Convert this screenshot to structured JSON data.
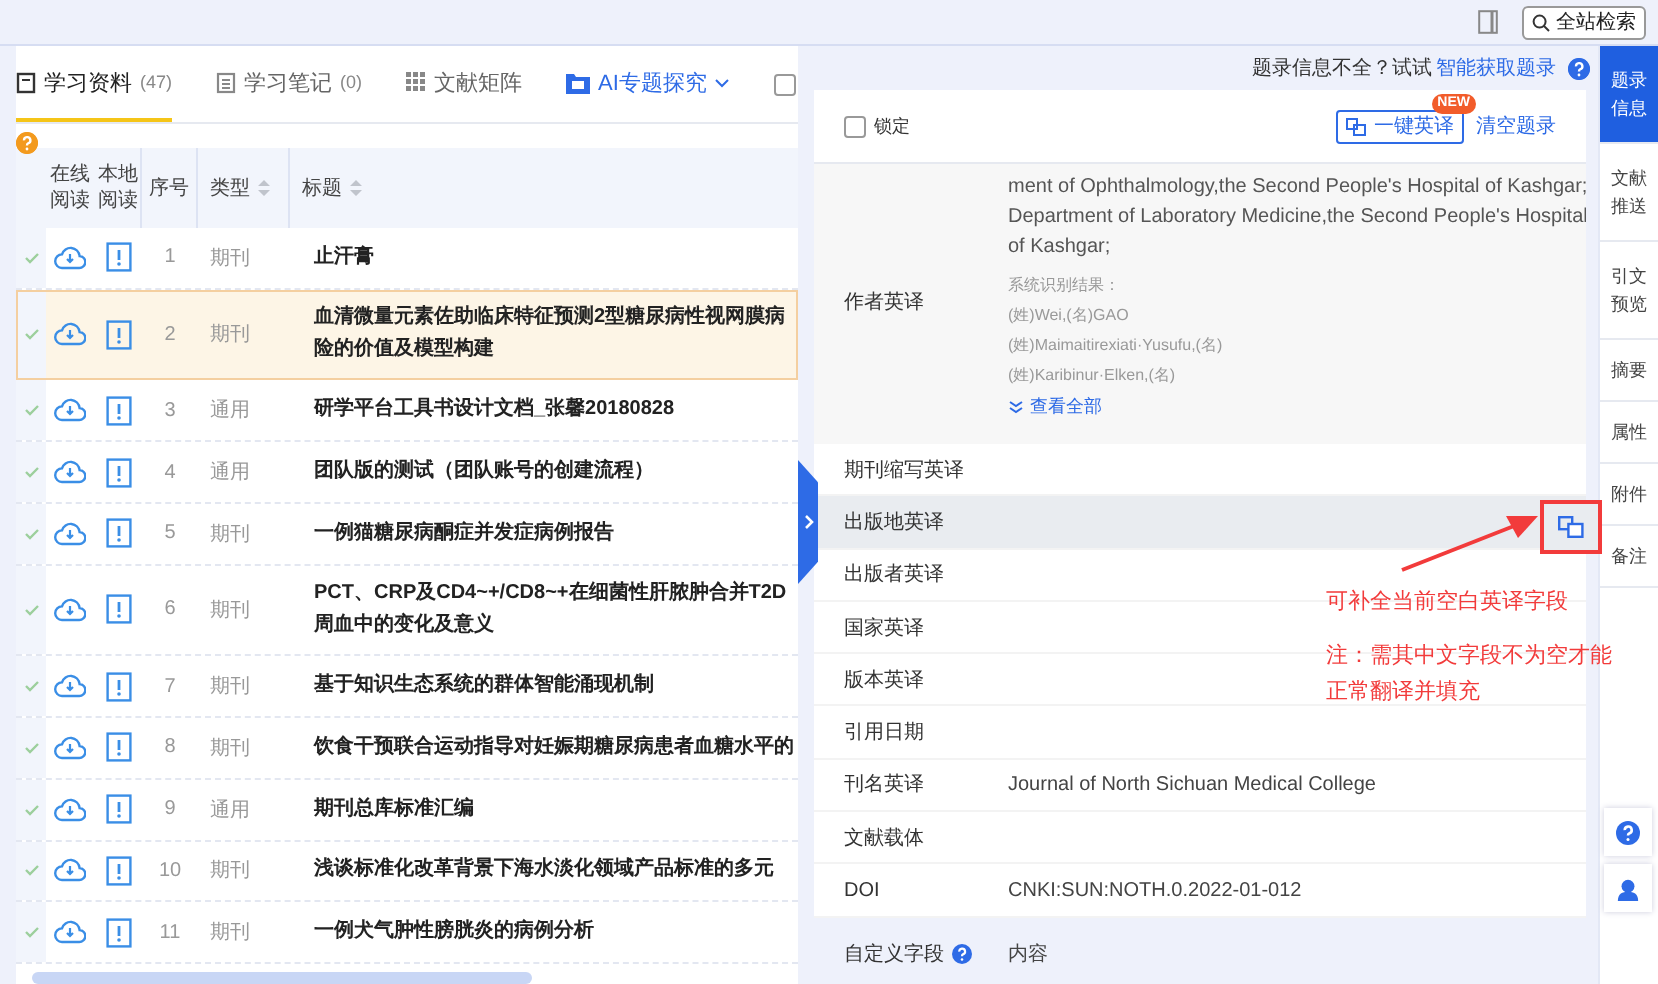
{
  "top_bar": {
    "search_button": "全站检索"
  },
  "tabs": [
    {
      "kind": "book",
      "label": "学习资料",
      "count": "(47)",
      "selected": true
    },
    {
      "kind": "notes",
      "label": "学习笔记",
      "count": "(0)",
      "selected": false
    },
    {
      "kind": "grid",
      "label": "文献矩阵",
      "selected": false
    },
    {
      "kind": "ai",
      "label": "AI专题探究",
      "selected": false
    }
  ],
  "filter_checkbox": {
    "checked": false
  },
  "table": {
    "columns": [
      "在线阅读",
      "本地阅读",
      "序号",
      "类型",
      "标题"
    ],
    "rows": [
      {
        "seq": "1",
        "type": "期刊",
        "title": "止汗膏",
        "selected": false
      },
      {
        "seq": "2",
        "type": "期刊",
        "title": "血清微量元素佐助临床特征预测2型糖尿病性视网膜病险的价值及模型构建",
        "selected": true
      },
      {
        "seq": "3",
        "type": "通用",
        "title": "研学平台工具书设计文档_张馨20180828",
        "selected": false
      },
      {
        "seq": "4",
        "type": "通用",
        "title": "团队版的测试（团队账号的创建流程）",
        "selected": false
      },
      {
        "seq": "5",
        "type": "期刊",
        "title": "一例猫糖尿病酮症并发症病例报告",
        "selected": false
      },
      {
        "seq": "6",
        "type": "期刊",
        "title": "PCT、CRP及CD4~+/CD8~+在细菌性肝脓肿合并T2D周血中的变化及意义",
        "selected": false
      },
      {
        "seq": "7",
        "type": "期刊",
        "title": "基于知识生态系统的群体智能涌现机制",
        "selected": false
      },
      {
        "seq": "8",
        "type": "期刊",
        "title": "饮食干预联合运动指导对妊娠期糖尿病患者血糖水平的",
        "selected": false
      },
      {
        "seq": "9",
        "type": "通用",
        "title": "期刊总库标准汇编",
        "selected": false
      },
      {
        "seq": "10",
        "type": "期刊",
        "title": "浅谈标准化改革背景下海水淡化领域产品标准的多元",
        "selected": false
      },
      {
        "seq": "11",
        "type": "期刊",
        "title": "一例犬气肿性膀胱炎的病例分析",
        "selected": false
      }
    ]
  },
  "notice": {
    "text": "题录信息不全？试试",
    "link": "智能获取题录"
  },
  "lock": {
    "label": "锁定",
    "checked": false
  },
  "translate_button": {
    "label": "一键英译",
    "badge": "NEW"
  },
  "clear_button": "清空题录",
  "author": {
    "label": "作者英译",
    "value": "ment of Ophthalmology,the Second People's Hospital of Kashgar;Department of Laboratory Medicine,the Second People's Hospital of Kashgar;",
    "recognized_title": "系统识别结果：",
    "recognized": [
      "(姓)Wei,(名)GAO",
      "(姓)Maimaitirexiati·Yusufu,(名)",
      "(姓)Karibinur·Elken,(名)"
    ],
    "more": "查看全部"
  },
  "fields": [
    {
      "label": "期刊缩写英译",
      "selected": false
    },
    {
      "label": "出版地英译",
      "selected": true
    },
    {
      "label": "出版者英译",
      "selected": false
    },
    {
      "label": "国家英译",
      "selected": false
    },
    {
      "label": "版本英译",
      "selected": false
    },
    {
      "label": "引用日期",
      "selected": false
    },
    {
      "label": "刊名英译",
      "value": "Journal of North Sichuan Medical College",
      "selected": false
    },
    {
      "label": "文献载体",
      "selected": false
    },
    {
      "label": "DOI",
      "value": "CNKI:SUN:NOTH.0.2022-01-012",
      "selected": false
    }
  ],
  "custom_field": {
    "label": "自定义字段",
    "value": "内容"
  },
  "side_tabs": [
    {
      "label": "题录信息",
      "selected": true
    },
    {
      "label": "文献推送",
      "selected": false
    },
    {
      "label": "引文预览",
      "selected": false
    },
    {
      "label": "摘要",
      "selected": false
    },
    {
      "label": "属性",
      "selected": false
    },
    {
      "label": "附件",
      "selected": false
    },
    {
      "label": "备注",
      "selected": false
    }
  ],
  "annotation": {
    "callout": "可补全当前空白英译字段",
    "note": "注：需其中文字段不为空才能正常翻译并填充"
  }
}
